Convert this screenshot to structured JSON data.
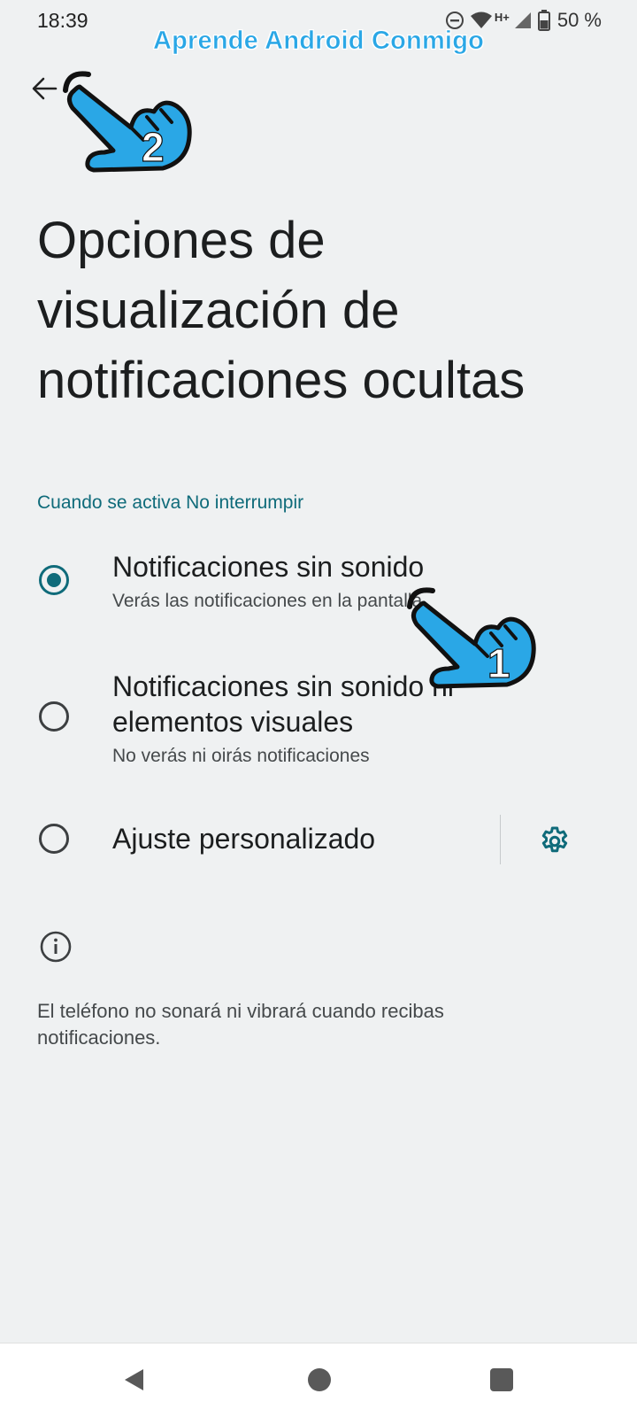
{
  "status_bar": {
    "time": "18:39",
    "network_label": "H+",
    "battery": "50 %"
  },
  "watermark": "Aprende Android Conmigo",
  "icons": {
    "back": "arrow-back-icon",
    "settings": "gear-icon",
    "info": "info-icon",
    "dnd": "do-not-disturb-icon",
    "wifi": "wifi-icon",
    "signal": "signal-icon",
    "battery": "battery-icon"
  },
  "page": {
    "title": "Opciones de visualización de notificaciones ocultas"
  },
  "section": {
    "header": "Cuando se activa No interrumpir"
  },
  "options": [
    {
      "title": "Notificaciones sin sonido",
      "subtitle": "Verás las notificaciones en la pantalla",
      "checked": true
    },
    {
      "title": "Notificaciones sin sonido ni elementos visuales",
      "subtitle": "No verás ni oirás notificaciones",
      "checked": false
    },
    {
      "title": "Ajuste personalizado",
      "checked": false
    }
  ],
  "footer": {
    "text": "El teléfono no sonará ni vibrará cuando recibas notificaciones."
  },
  "annotations": {
    "step1": "1",
    "step2": "2",
    "accent_color": "#2aa7e6"
  },
  "colors": {
    "accent": "#0f6b7a",
    "background": "#eff1f2"
  }
}
